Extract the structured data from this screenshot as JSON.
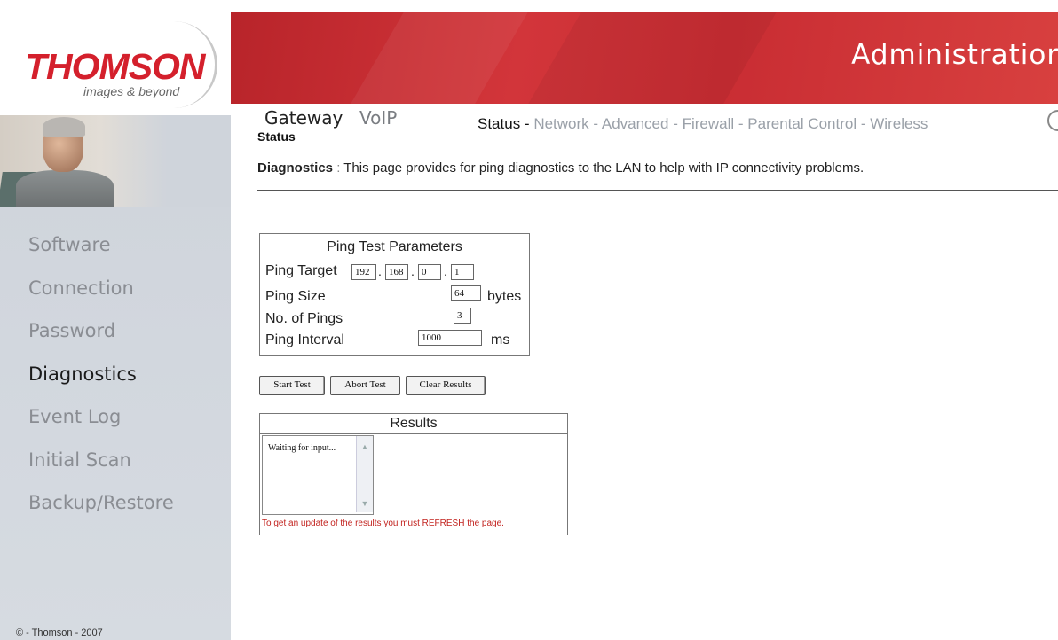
{
  "brand": {
    "name": "THOMSON",
    "tagline": "images & beyond"
  },
  "header": {
    "title": "Administration"
  },
  "topnav": {
    "tabs": [
      "Gateway",
      "VoIP"
    ],
    "active_tab": "Gateway",
    "subnav": [
      {
        "label": "Status -",
        "selected": true
      },
      {
        "label": "Network -",
        "selected": false
      },
      {
        "label": "Advanced -",
        "selected": false
      },
      {
        "label": "Firewall -",
        "selected": false
      },
      {
        "label": "Parental Control -",
        "selected": false
      },
      {
        "label": "Wireless",
        "selected": false
      }
    ]
  },
  "sidebar": {
    "items": [
      {
        "label": "Software",
        "active": false
      },
      {
        "label": "Connection",
        "active": false
      },
      {
        "label": "Password",
        "active": false
      },
      {
        "label": "Diagnostics",
        "active": true
      },
      {
        "label": "Event Log",
        "active": false
      },
      {
        "label": "Initial Scan",
        "active": false
      },
      {
        "label": "Backup/Restore",
        "active": false
      }
    ],
    "copyright": "© - Thomson - 2007"
  },
  "main": {
    "section_title": "Status",
    "desc_label": "Diagnostics",
    "desc_sep": " : ",
    "desc_text": "This page provides for ping diagnostics to the LAN to help with IP connectivity problems."
  },
  "params": {
    "title": "Ping Test Parameters",
    "ping_target_label": "Ping Target",
    "ping_target": [
      "192",
      "168",
      "0",
      "1"
    ],
    "ping_size_label": "Ping Size",
    "ping_size": "64",
    "ping_size_unit": "bytes",
    "num_pings_label": "No. of Pings",
    "num_pings": "3",
    "interval_label": "Ping Interval",
    "interval": "1000",
    "interval_unit": "ms"
  },
  "buttons": {
    "start": "Start Test",
    "abort": "Abort Test",
    "clear": "Clear Results"
  },
  "results": {
    "title": "Results",
    "value": "Waiting for input...",
    "note": "To get an update of the results you must REFRESH the page."
  }
}
